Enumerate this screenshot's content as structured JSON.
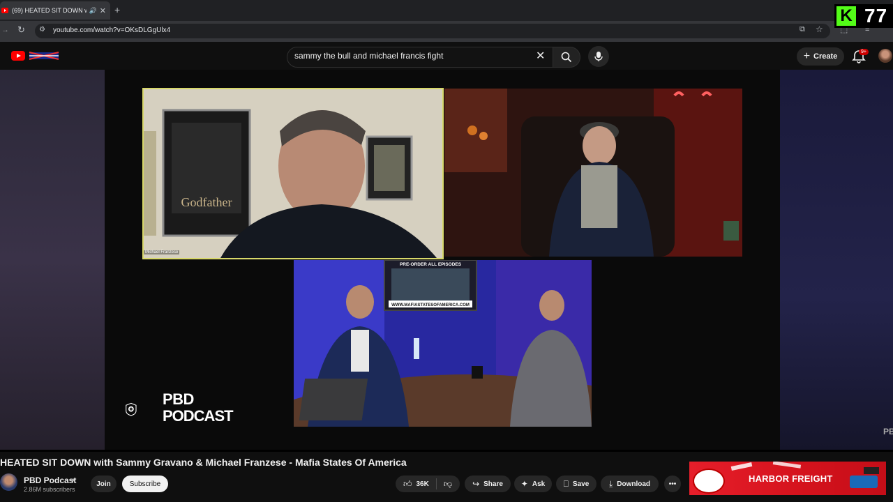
{
  "browser": {
    "tab_title": "(69) HEATED SIT DOWN wi",
    "url": "youtube.com/watch?v=OKsDLGgUlx4"
  },
  "overlay": {
    "kick_count": "77"
  },
  "youtube": {
    "search_query": "sammy the bull and michael francis fight",
    "create_label": "Create",
    "notification_badge": "9+"
  },
  "video": {
    "participant_label": "Michael Franzese",
    "poster_text": "Godfather",
    "banner_line1": "PRE-ORDER ALL EPISODES",
    "banner_url": "WWW.MAFIASTATESOFAMERICA.COM",
    "channel_logo_line1": "PBD",
    "channel_logo_line2": "PODCAST",
    "watermark": "PB"
  },
  "meta": {
    "title": "HEATED SIT DOWN with Sammy Gravano & Michael Franzese - Mafia States Of America",
    "channel_name": "PBD Podcast",
    "subscribers": "2.86M subscribers",
    "join_label": "Join",
    "subscribe_label": "Subscribe",
    "like_count": "36K",
    "share_label": "Share",
    "ask_label": "Ask",
    "save_label": "Save",
    "download_label": "Download"
  },
  "ad": {
    "brand": "HARBOR FREIGHT"
  },
  "colors": {
    "youtube_red": "#ff0000",
    "kick_green": "#53fc18",
    "ad_red": "#e61e2a"
  }
}
